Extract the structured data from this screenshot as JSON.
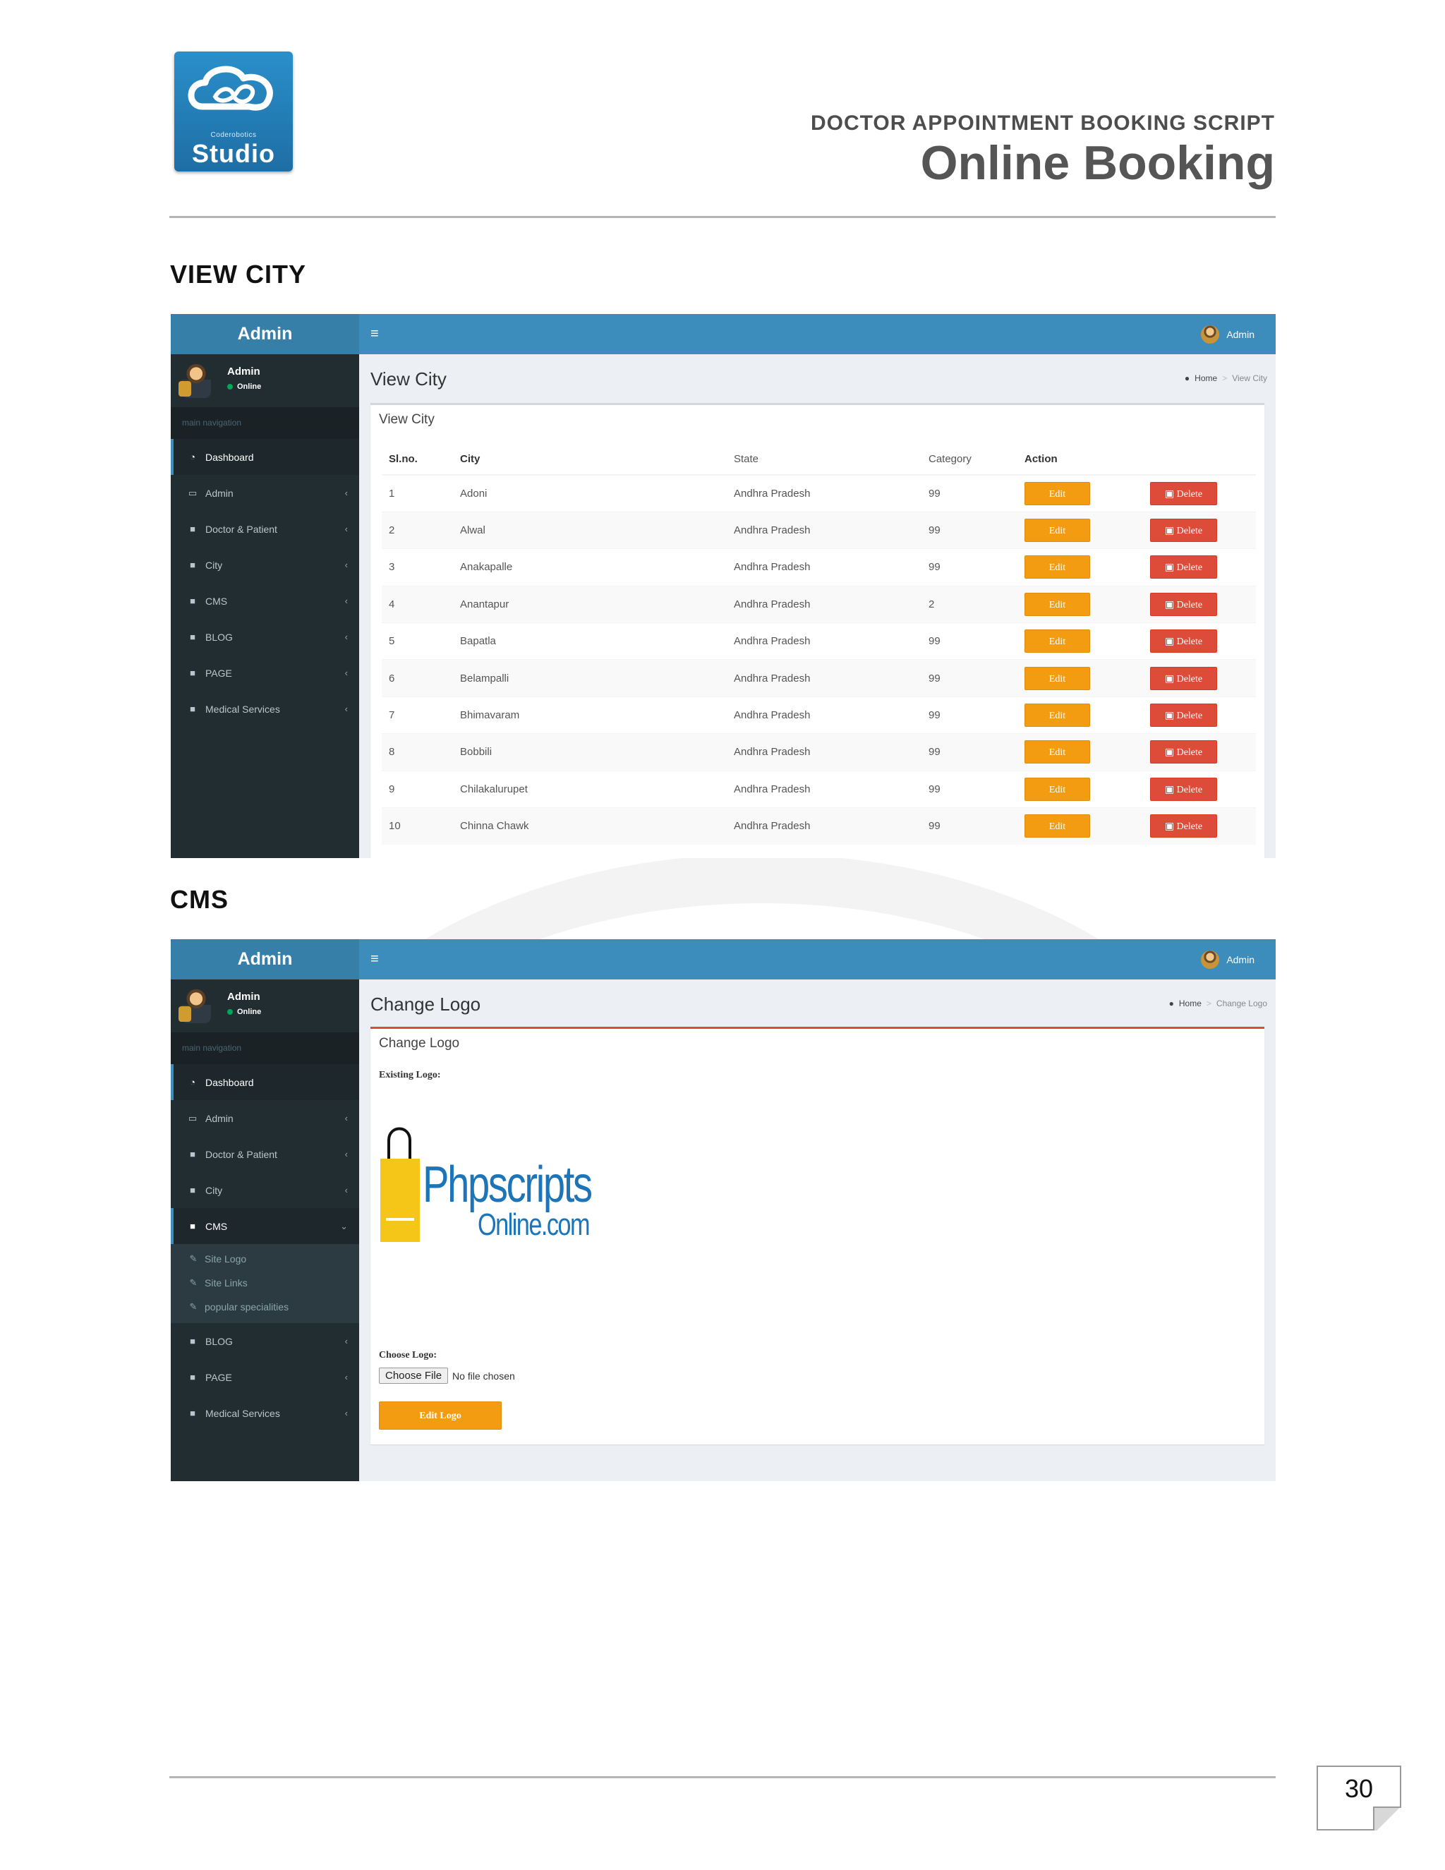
{
  "brand_logo": {
    "tagline": "Coderobotics",
    "word": "Studio"
  },
  "document": {
    "kicker": "DOCTOR APPOINTMENT BOOKING SCRIPT",
    "title": "Online Booking",
    "page_number": "30"
  },
  "sections": {
    "view_city": "VIEW CITY",
    "cms": "CMS"
  },
  "admin": {
    "brand": "Admin",
    "menu_glyph": "≡",
    "top_user": "Admin",
    "user_name": "Admin",
    "user_status": "Online",
    "nav_header": "main navigation"
  },
  "nav_items": [
    {
      "label": "Dashboard",
      "icon": "dashboard-icon"
    },
    {
      "label": "Admin",
      "icon": "laptop-icon"
    },
    {
      "label": "Doctor & Patient",
      "icon": "folder-icon"
    },
    {
      "label": "City",
      "icon": "folder-icon"
    },
    {
      "label": "CMS",
      "icon": "folder-icon"
    },
    {
      "label": "BLOG",
      "icon": "folder-icon"
    },
    {
      "label": "PAGE",
      "icon": "folder-icon"
    },
    {
      "label": "Medical Services",
      "icon": "folder-icon"
    }
  ],
  "cms_subnav": [
    "Site Logo",
    "Site Links",
    "popular specialities"
  ],
  "view_city": {
    "page_title": "View City",
    "breadcrumb": {
      "home": "Home",
      "current": "View City"
    },
    "box_title": "View City",
    "columns": [
      "Sl.no.",
      "City",
      "State",
      "Category",
      "Action"
    ],
    "edit_label": "Edit",
    "delete_label": "Delete",
    "rows": [
      {
        "sl": "1",
        "city": "Adoni",
        "state": "Andhra Pradesh",
        "category": "99"
      },
      {
        "sl": "2",
        "city": "Alwal",
        "state": "Andhra Pradesh",
        "category": "99"
      },
      {
        "sl": "3",
        "city": "Anakapalle",
        "state": "Andhra Pradesh",
        "category": "99"
      },
      {
        "sl": "4",
        "city": "Anantapur",
        "state": "Andhra Pradesh",
        "category": "2"
      },
      {
        "sl": "5",
        "city": "Bapatla",
        "state": "Andhra Pradesh",
        "category": "99"
      },
      {
        "sl": "6",
        "city": "Belampalli",
        "state": "Andhra Pradesh",
        "category": "99"
      },
      {
        "sl": "7",
        "city": "Bhimavaram",
        "state": "Andhra Pradesh",
        "category": "99"
      },
      {
        "sl": "8",
        "city": "Bobbili",
        "state": "Andhra Pradesh",
        "category": "99"
      },
      {
        "sl": "9",
        "city": "Chilakalurupet",
        "state": "Andhra Pradesh",
        "category": "99"
      },
      {
        "sl": "10",
        "city": "Chinna Chawk",
        "state": "Andhra Pradesh",
        "category": "99"
      }
    ]
  },
  "change_logo": {
    "page_title": "Change Logo",
    "breadcrumb": {
      "home": "Home",
      "current": "Change Logo"
    },
    "box_title": "Change Logo",
    "existing_label": "Existing Logo:",
    "existing_logo": {
      "word": "Phpscripts",
      "sub": "Online.com"
    },
    "choose_label": "Choose Logo:",
    "file_button": "Choose File",
    "file_status": "No file chosen",
    "submit_label": "Edit Logo"
  },
  "colors": {
    "header": "#3c8dbc",
    "sidebar": "#222d32",
    "edit": "#f39c12",
    "delete": "#dd4b39"
  }
}
